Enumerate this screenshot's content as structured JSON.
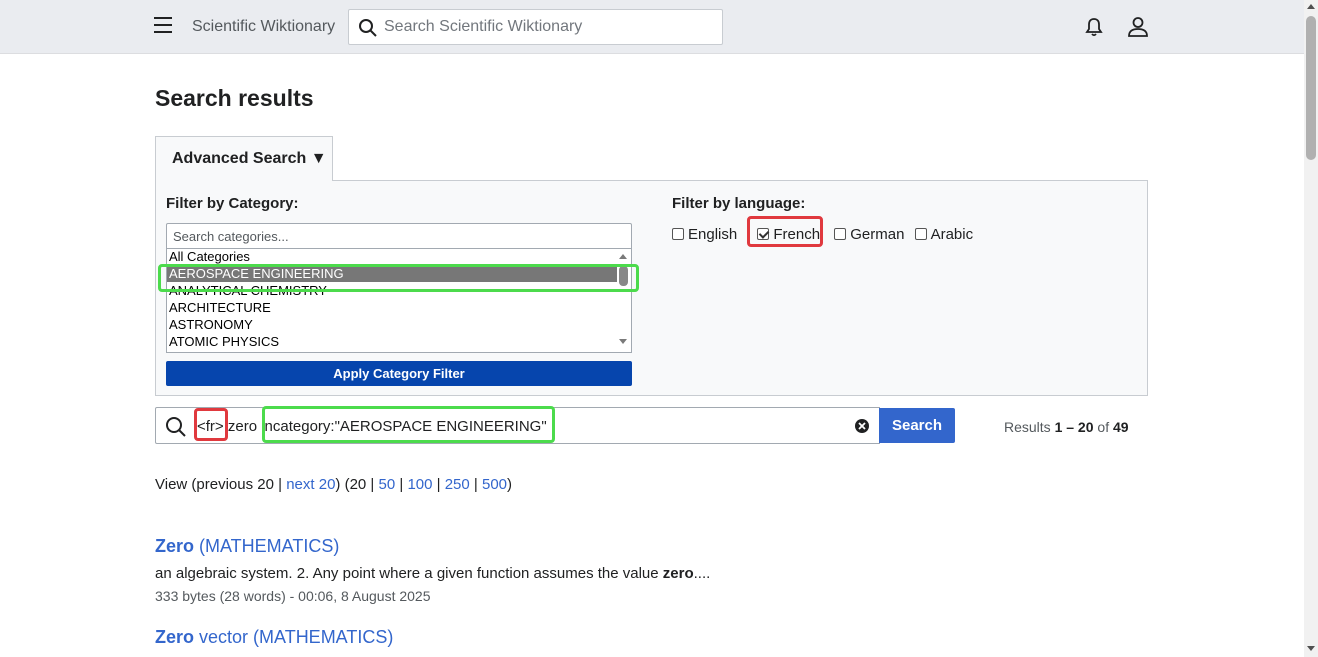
{
  "header": {
    "site_title": "Scientific Wiktionary",
    "search_placeholder": "Search Scientific Wiktionary"
  },
  "page": {
    "title": "Search results"
  },
  "advanced": {
    "tab_label": "Advanced Search ▼",
    "category_heading": "Filter by Category:",
    "category_search_placeholder": "Search categories...",
    "categories": [
      "All Categories",
      "AEROSPACE ENGINEERING",
      "ANALYTICAL CHEMISTRY",
      "ARCHITECTURE",
      "ASTRONOMY",
      "ATOMIC PHYSICS"
    ],
    "selected_category": "AEROSPACE ENGINEERING",
    "apply_label": "Apply Category Filter",
    "language_heading": "Filter by language:",
    "languages": [
      {
        "label": "English",
        "checked": false
      },
      {
        "label": "French",
        "checked": true
      },
      {
        "label": "German",
        "checked": false
      },
      {
        "label": "Arabic",
        "checked": false
      }
    ]
  },
  "search": {
    "query_lang_tag": "<fr>",
    "query_term": "zero",
    "query_category": "incategory:\"AEROSPACE ENGINEERING\"",
    "button_label": "Search",
    "results_prefix": "Results",
    "results_range": "1 – 20",
    "results_of": "of",
    "results_total": "49"
  },
  "view": {
    "prefix": "View (previous 20 |",
    "next_link": "next 20",
    "mid": ") (20 |",
    "sizes": [
      "50",
      "100",
      "250",
      "500"
    ],
    "sep": "|",
    "suffix": ")"
  },
  "results": [
    {
      "title_bold": "Zero",
      "title_rest": " (MATHEMATICS)",
      "snippet_pre": "an algebraic system. 2. Any point where a given function assumes the value ",
      "snippet_bold": "zero",
      "snippet_post": "....",
      "meta": "333 bytes (28 words) - 00:06, 8 August 2025"
    },
    {
      "title_bold": "Zero",
      "title_rest": " vector (MATHEMATICS)"
    }
  ],
  "highlight_colors": {
    "green": "#4cdb4c",
    "red": "#e0393e"
  },
  "accent": "#3366cc"
}
